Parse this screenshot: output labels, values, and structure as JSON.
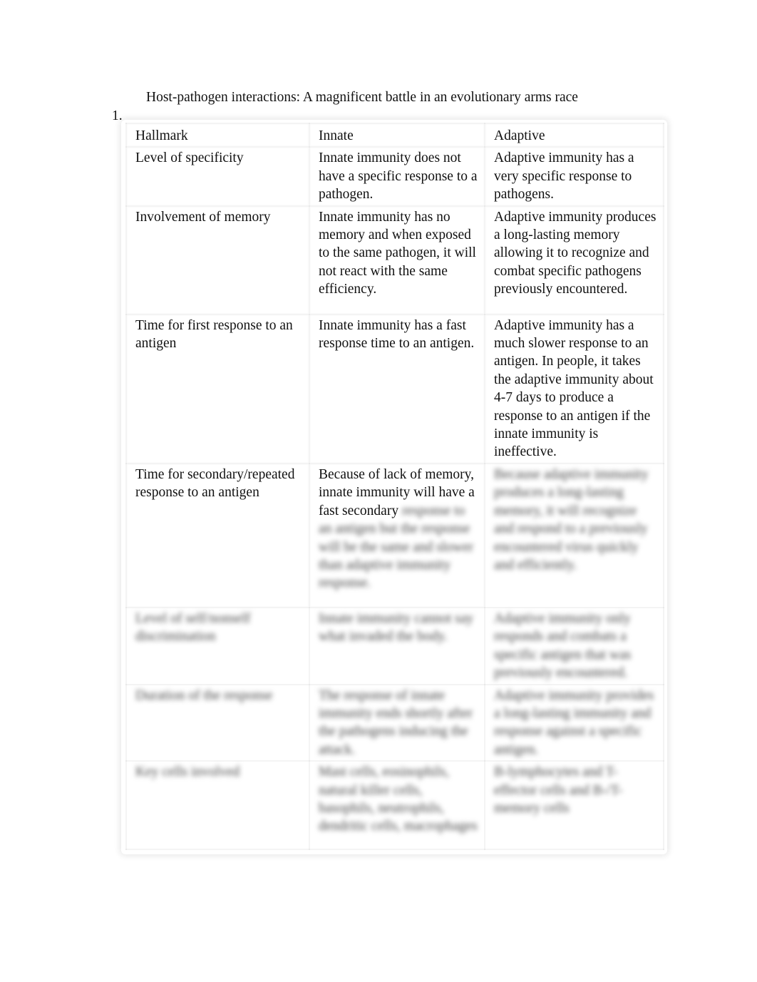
{
  "document": {
    "title": "Host-pathogen interactions: A magnificent battle in an evolutionary arms race",
    "list_number": "1."
  },
  "table": {
    "headers": [
      "Hallmark",
      "Innate",
      "Adaptive"
    ],
    "rows": [
      {
        "hallmark": "Level of specificity",
        "innate": "Innate immunity does not have a specific response to a pathogen.",
        "adaptive": "Adaptive immunity has a very specific response to pathogens."
      },
      {
        "hallmark": "Involvement of memory",
        "innate": "Innate immunity has no memory and when exposed to the same pathogen, it will not react with the same efficiency.",
        "adaptive": "Adaptive immunity produces a long-lasting memory allowing it to recognize and combat specific pathogens previously encountered."
      },
      {
        "hallmark": "Time for first response to an antigen",
        "innate": "Innate immunity has a fast response time to an antigen.",
        "adaptive": "Adaptive immunity has a much slower response to an antigen. In people, it takes the adaptive immunity about 4-7 days to produce a response to an antigen if the innate immunity is ineffective."
      },
      {
        "hallmark": "Time for secondary/repeated response to an antigen",
        "innate": "Because of lack of memory, innate immunity will have a fast secondary",
        "innate_blurred": "response to an antigen but the response will be the same and slower than adaptive immunity response.",
        "adaptive_blurred": "Because adaptive immunity produces a long-lasting memory, it will recognize and respond to a previously encountered virus quickly and efficiently."
      },
      {
        "hallmark_blurred": "Level of self/nonself discrimination",
        "innate_blurred": "Innate immunity cannot say what invaded the body.",
        "adaptive_blurred": "Adaptive immunity only responds and combats a specific antigen that was previously encountered."
      },
      {
        "hallmark_blurred": "Duration of the response",
        "innate_blurred": "The response of innate immunity ends shortly after the pathogens inducing the attack.",
        "adaptive_blurred": "Adaptive immunity provides a long-lasting immunity and response against a specific antigen."
      },
      {
        "hallmark_blurred": "Key cells involved",
        "innate_blurred": "Mast cells, eosinophils, natural killer cells, basophils, neutrophils, dendritic cells, macrophages",
        "adaptive_blurred": "B-lymphocytes and T-effector cells and B-/T-memory cells"
      }
    ]
  }
}
